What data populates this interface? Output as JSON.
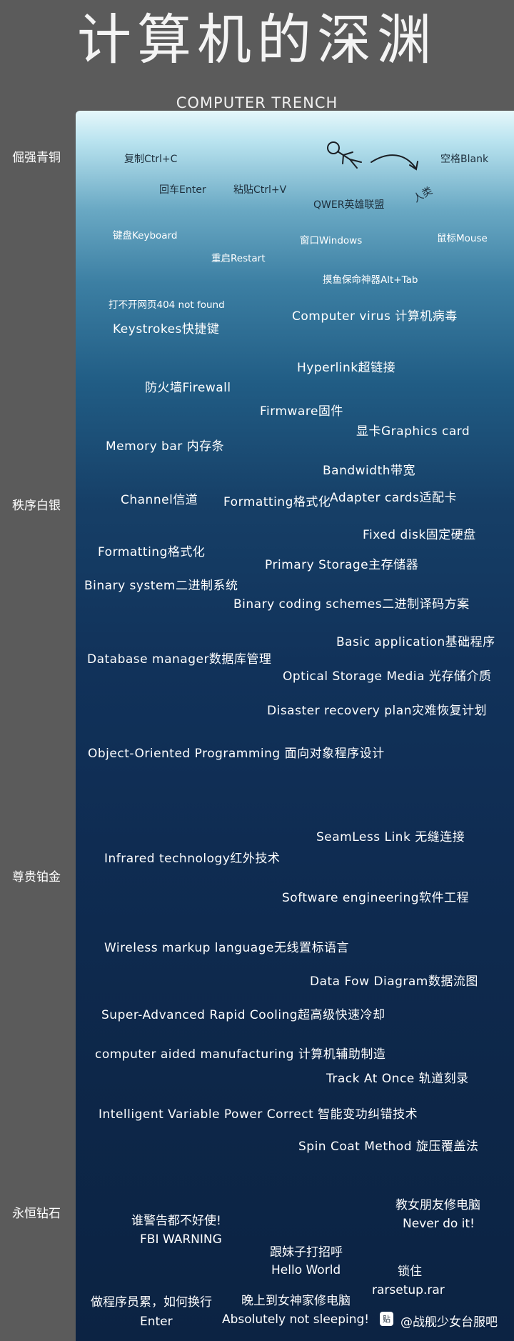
{
  "title": "计算机的深渊",
  "subtitle": "COMPUTER TRENCH",
  "tiers": [
    "倔强青铜",
    "秩序白银",
    "尊贵铂金",
    "永恒钻石"
  ],
  "terms": {
    "copy": "复制Ctrl+C",
    "blank": "空格Blank",
    "human": "人类",
    "enter": "回车Enter",
    "paste": "粘贴Ctrl+V",
    "qwer": "QWER英雄联盟",
    "keyboard": "键盘Keyboard",
    "window": "窗口Windows",
    "mouse": "鼠标Mouse",
    "restart": "重启Restart",
    "alt_tab": "摸鱼保命神器Alt+Tab",
    "err404": "打不开网页404 not found",
    "virus": "Computer virus 计算机病毒",
    "keystrokes": "Keystrokes快捷键",
    "hyperlink": "Hyperlink超链接",
    "firewall": "防火墙Firewall",
    "firmware": "Firmware固件",
    "graphics": "显卡Graphics card",
    "memory": "Memory bar 内存条",
    "bandwidth": "Bandwidth带宽",
    "channel": "Channel信道",
    "formatting1": "Formatting格式化",
    "adapter": "Adapter cards适配卡",
    "fixed_disk": "Fixed disk固定硬盘",
    "formatting2": "Formatting格式化",
    "primary": "Primary Storage主存储器",
    "binary": "Binary system二进制系统",
    "binary_coding": "Binary coding schemes二进制译码方案",
    "basic_app": "Basic application基础程序",
    "database": "Database manager数据库管理",
    "optical": "Optical Storage Media 光存储介质",
    "disaster": "Disaster recovery plan灾难恢复计划",
    "oop": "Object-Oriented Programming 面向对象程序设计",
    "seamless": "SeamLess Link 无缝连接",
    "infrared": "Infrared technology红外技术",
    "software": "Software engineering软件工程",
    "wml": "Wireless markup language无线置标语言",
    "dfd": "Data Fow Diagram数据流图",
    "cooling": "Super-Advanced Rapid Cooling超高级快速冷却",
    "cam": "computer aided manufacturing 计算机辅助制造",
    "track": "Track At Once 轨道刻录",
    "ivpc": "Intelligent Variable Power Correct 智能变功纠错技术",
    "spin": "Spin Coat Method 旋压覆盖法",
    "gf_repair": "教女朋友修电脑",
    "never": "Never do it!",
    "warning_useless": "谁警告都不好使!",
    "fbi": "FBI WARNING",
    "sister": "跟妹子打招呼",
    "hello": "Hello World",
    "lock": "锁住",
    "rarsetup": "rarsetup.rar",
    "newline": "做程序员累，如何换行",
    "goddess": "晚上到女神家修电脑",
    "enter2": "Enter",
    "no_sleep": "Absolutely not sleeping!"
  },
  "watermark": {
    "badge": "贴",
    "text": "@战舰少女台服吧"
  }
}
